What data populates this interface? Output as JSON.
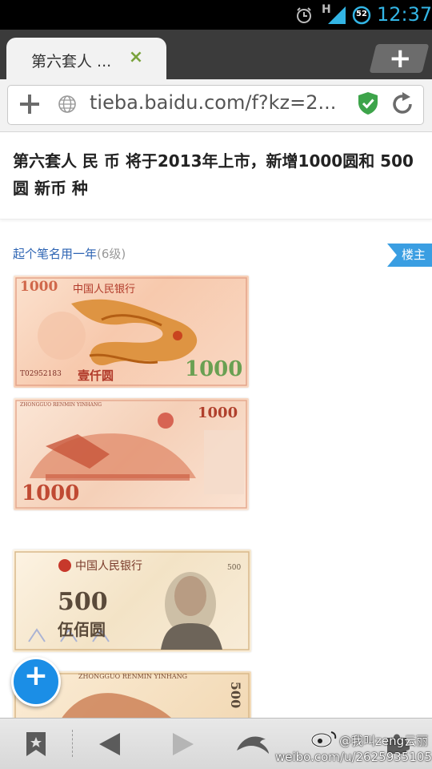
{
  "status_bar": {
    "network": "H",
    "battery": "52",
    "time": "12:37",
    "accent_color": "#33b5e5"
  },
  "tab": {
    "title": "第六套人 ...",
    "close_symbol": "×",
    "new_tab_symbol": "+"
  },
  "url_bar": {
    "url": "tieba.baidu.com/f?kz=2..."
  },
  "post": {
    "title": "第六套人 民 币 将于2013年上市，新增1000圆和 500圆 新币 种",
    "author": "起个笔名用一年",
    "level": "(6级)",
    "owner_badge": "楼主"
  },
  "banknotes": [
    {
      "name": "1000-yuan-front",
      "issuer": "中国人民银行",
      "value": "1000",
      "words": "壹仟圆",
      "serial": "T02952183"
    },
    {
      "name": "1000-yuan-back",
      "pinyin": "ZHONGGUO RENMIN YINHANG",
      "value": "1000"
    },
    {
      "name": "500-yuan-front",
      "issuer": "中国人民银行",
      "value": "500",
      "words": "伍佰圆"
    },
    {
      "name": "500-yuan-back",
      "pinyin": "ZHONGGUO RENMIN YINHANG",
      "value": "500"
    }
  ],
  "fab": {
    "symbol": "+"
  },
  "icons": [
    "clock-icon",
    "signal-icon",
    "battery-icon",
    "bookmark-add-icon",
    "globe-icon",
    "shield-icon",
    "refresh-icon",
    "bookmarks-icon",
    "back-icon",
    "forward-icon",
    "dolphin-icon",
    "addons-icon",
    "weibo-icon"
  ],
  "watermark": {
    "line1": "@我叫zeng云丽",
    "line2": "weibo.com/u/2625935105"
  }
}
